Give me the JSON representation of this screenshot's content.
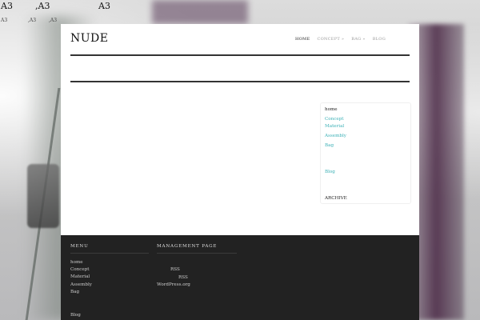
{
  "stray_text": {
    "top": [
      "A3",
      ",A3",
      "A3"
    ],
    "small": [
      "A3",
      ",A3",
      ",A3"
    ]
  },
  "site": {
    "logo": "NUDE"
  },
  "nav": [
    {
      "label": "HOME",
      "active": true
    },
    {
      "label": "CONCEPT »",
      "active": false
    },
    {
      "label": "BAG »",
      "active": false
    },
    {
      "label": "BLOG",
      "active": false
    }
  ],
  "sidebar": {
    "heading": "home",
    "links": [
      "Concept",
      "Material",
      "Assembly",
      "Bag",
      "Blog"
    ],
    "archive": "ARCHIVE"
  },
  "footer": {
    "menu_title": "MENU",
    "menu_links": [
      "home",
      "Concept",
      "Material",
      "Assembly",
      "Bag",
      "Blog"
    ],
    "management_title": "MANAGEMENT PAGE",
    "management_links": [
      "RSS",
      "RSS",
      "WordPress.org"
    ]
  }
}
